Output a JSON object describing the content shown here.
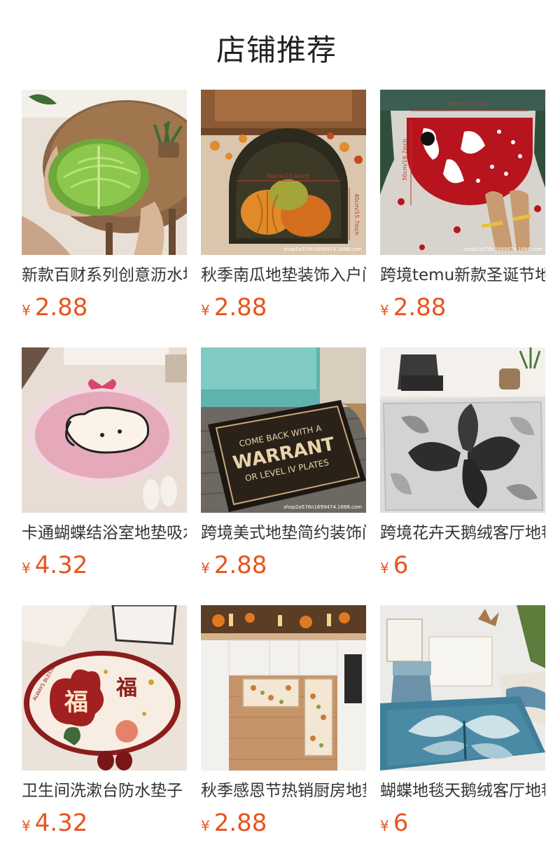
{
  "header": {
    "title": "店铺推荐"
  },
  "products": [
    {
      "name": "新款百财系列创意沥水地垫",
      "currency": "¥",
      "price": "2.88",
      "icon": "cabbage-mat-image"
    },
    {
      "name": "秋季南瓜地垫装饰入户门垫",
      "currency": "¥",
      "price": "2.88",
      "icon": "pumpkin-mat-image",
      "img_text": {
        "dim1": "60cm/23.6inch",
        "dim2": "40cm/15.7inch",
        "watermark": "shop2a576n1699474.1688.com"
      }
    },
    {
      "name": "跨境temu新款圣诞节地垫",
      "currency": "¥",
      "price": "2.88",
      "icon": "christmas-mat-image",
      "img_text": {
        "dim1": "80cm/31.5inch",
        "dim2": "50cm/19.7inch",
        "watermark": "shop2a576n1699474.1688.com"
      }
    },
    {
      "name": "卡通蝴蝶结浴室地垫吸水",
      "currency": "¥",
      "price": "4.32",
      "icon": "puppy-mat-image"
    },
    {
      "name": "跨境美式地垫简约装饰门垫",
      "currency": "¥",
      "price": "2.88",
      "icon": "warrant-mat-image",
      "img_text": {
        "line1": "COME BACK WITH A",
        "line2": "WARRANT",
        "line3": "OR LEVEL IV PLATES",
        "watermark": "shop2a576n1699474.1688.com"
      }
    },
    {
      "name": "跨境花卉天鹅绒客厅地毯",
      "currency": "¥",
      "price": "6",
      "icon": "flower-rug-image"
    },
    {
      "name": "卫生间洗漱台防水垫子",
      "currency": "¥",
      "price": "4.32",
      "icon": "fu-mat-image",
      "img_text": {
        "char1": "福",
        "char2": "福",
        "ring": "ALWAYS BLESSED"
      }
    },
    {
      "name": "秋季感恩节热销厨房地垫",
      "currency": "¥",
      "price": "2.88",
      "icon": "kitchen-mat-image"
    },
    {
      "name": "蝴蝶地毯天鹅绒客厅地毯",
      "currency": "¥",
      "price": "6",
      "icon": "butterfly-rug-image"
    }
  ]
}
